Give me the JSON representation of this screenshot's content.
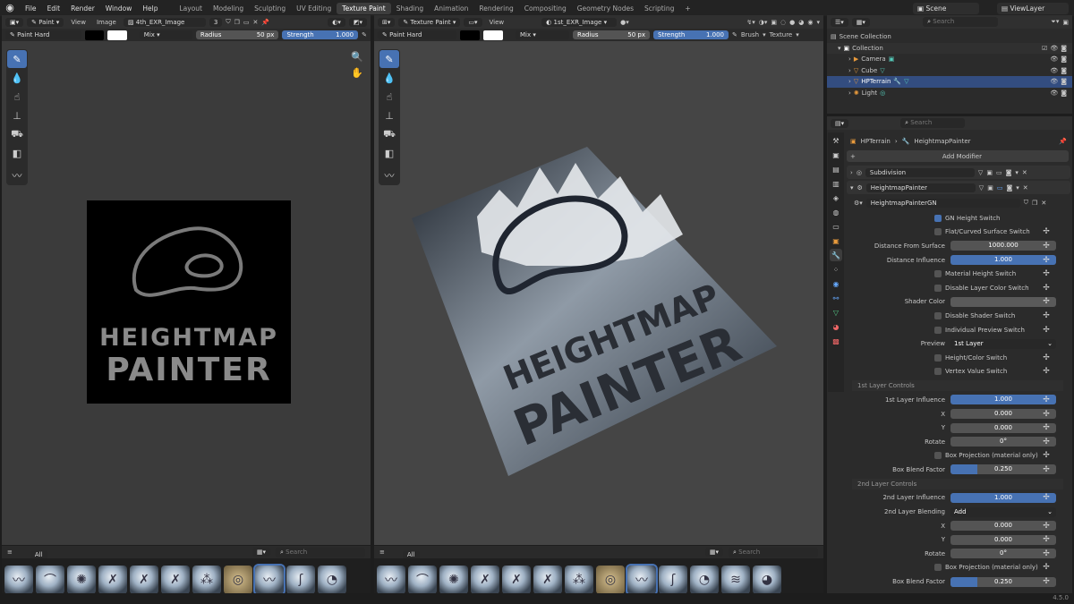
{
  "topbar": {
    "menus": [
      "File",
      "Edit",
      "Render",
      "Window",
      "Help"
    ],
    "workspaces": [
      "Layout",
      "Modeling",
      "Sculpting",
      "UV Editing",
      "Texture Paint",
      "Shading",
      "Animation",
      "Rendering",
      "Compositing",
      "Geometry Nodes",
      "Scripting"
    ],
    "active_workspace": "Texture Paint",
    "scene": "Scene",
    "view_layer": "ViewLayer"
  },
  "image_editor": {
    "mode": "Paint",
    "view": "View",
    "image_menu": "Image",
    "image_name": "4th_EXR_Image",
    "users": "3",
    "brush": "Paint Hard",
    "blend": "Mix",
    "radius_label": "Radius",
    "radius_value": "50 px",
    "strength_label": "Strength",
    "strength_value": "1.000",
    "canvas_line1": "HEIGHTMAP",
    "canvas_line2": "PAINTER"
  },
  "viewport": {
    "mode": "Texture Paint",
    "view": "View",
    "image_name": "1st_EXR_Image",
    "brush": "Paint Hard",
    "blend": "Mix",
    "radius_label": "Radius",
    "radius_value": "50 px",
    "strength_label": "Strength",
    "strength_value": "1.000",
    "brush_menu": "Brush",
    "texture_menu": "Texture",
    "model_line1": "HEIGHTMAP",
    "model_line2": "PAINTER"
  },
  "brush_bar": {
    "tab": "All",
    "search_placeholder": "Search"
  },
  "outliner": {
    "search_placeholder": "Search",
    "root": "Scene Collection",
    "collection": "Collection",
    "items": [
      "Camera",
      "Cube",
      "HPTerrain",
      "Light"
    ],
    "selected": "HPTerrain"
  },
  "properties": {
    "search_placeholder": "Search",
    "object": "HPTerrain",
    "modifier_crumb": "HeightmapPainter",
    "add_modifier": "Add Modifier",
    "mod1": "Subdivision",
    "mod2": "HeightmapPainter",
    "node_group": "HeightmapPainterGN",
    "rows": {
      "gn_height_switch": "GN Height Switch",
      "flat_curved": "Flat/Curved Surface Switch",
      "distance_from_surface_label": "Distance From Surface",
      "distance_from_surface": "1000.000",
      "distance_influence_label": "Distance Influence",
      "distance_influence": "1.000",
      "material_height": "Material Height Switch",
      "disable_layer_color": "Disable Layer Color Switch",
      "shader_color_label": "Shader Color",
      "disable_shader": "Disable Shader Switch",
      "individual_preview": "Individual Preview Switch",
      "preview_label": "Preview",
      "preview_value": "1st Layer",
      "height_color": "Height/Color Switch",
      "vertex_value": "Vertex Value Switch"
    },
    "layer1": {
      "section": "1st Layer Controls",
      "influence_label": "1st Layer Influence",
      "influence": "1.000",
      "x_label": "X",
      "x": "0.000",
      "y_label": "Y",
      "y": "0.000",
      "rotate_label": "Rotate",
      "rotate": "0°",
      "box_projection": "Box Projection (material only)",
      "blend_label": "Box Blend Factor",
      "blend": "0.250",
      "blend_fill": 0.25
    },
    "layer2": {
      "section": "2nd Layer Controls",
      "influence_label": "2nd Layer Influence",
      "influence": "1.000",
      "blending_label": "2nd Layer Blending",
      "blending": "Add",
      "x_label": "X",
      "x": "0.000",
      "y_label": "Y",
      "y": "0.000",
      "rotate_label": "Rotate",
      "rotate": "0°",
      "box_projection": "Box Projection (material only)",
      "blend_label": "Box Blend Factor",
      "blend": "0.250",
      "blend_fill": 0.25
    }
  },
  "version": "4.5.0",
  "colors": {
    "accent": "#4772b3",
    "selection": "#334d80"
  }
}
